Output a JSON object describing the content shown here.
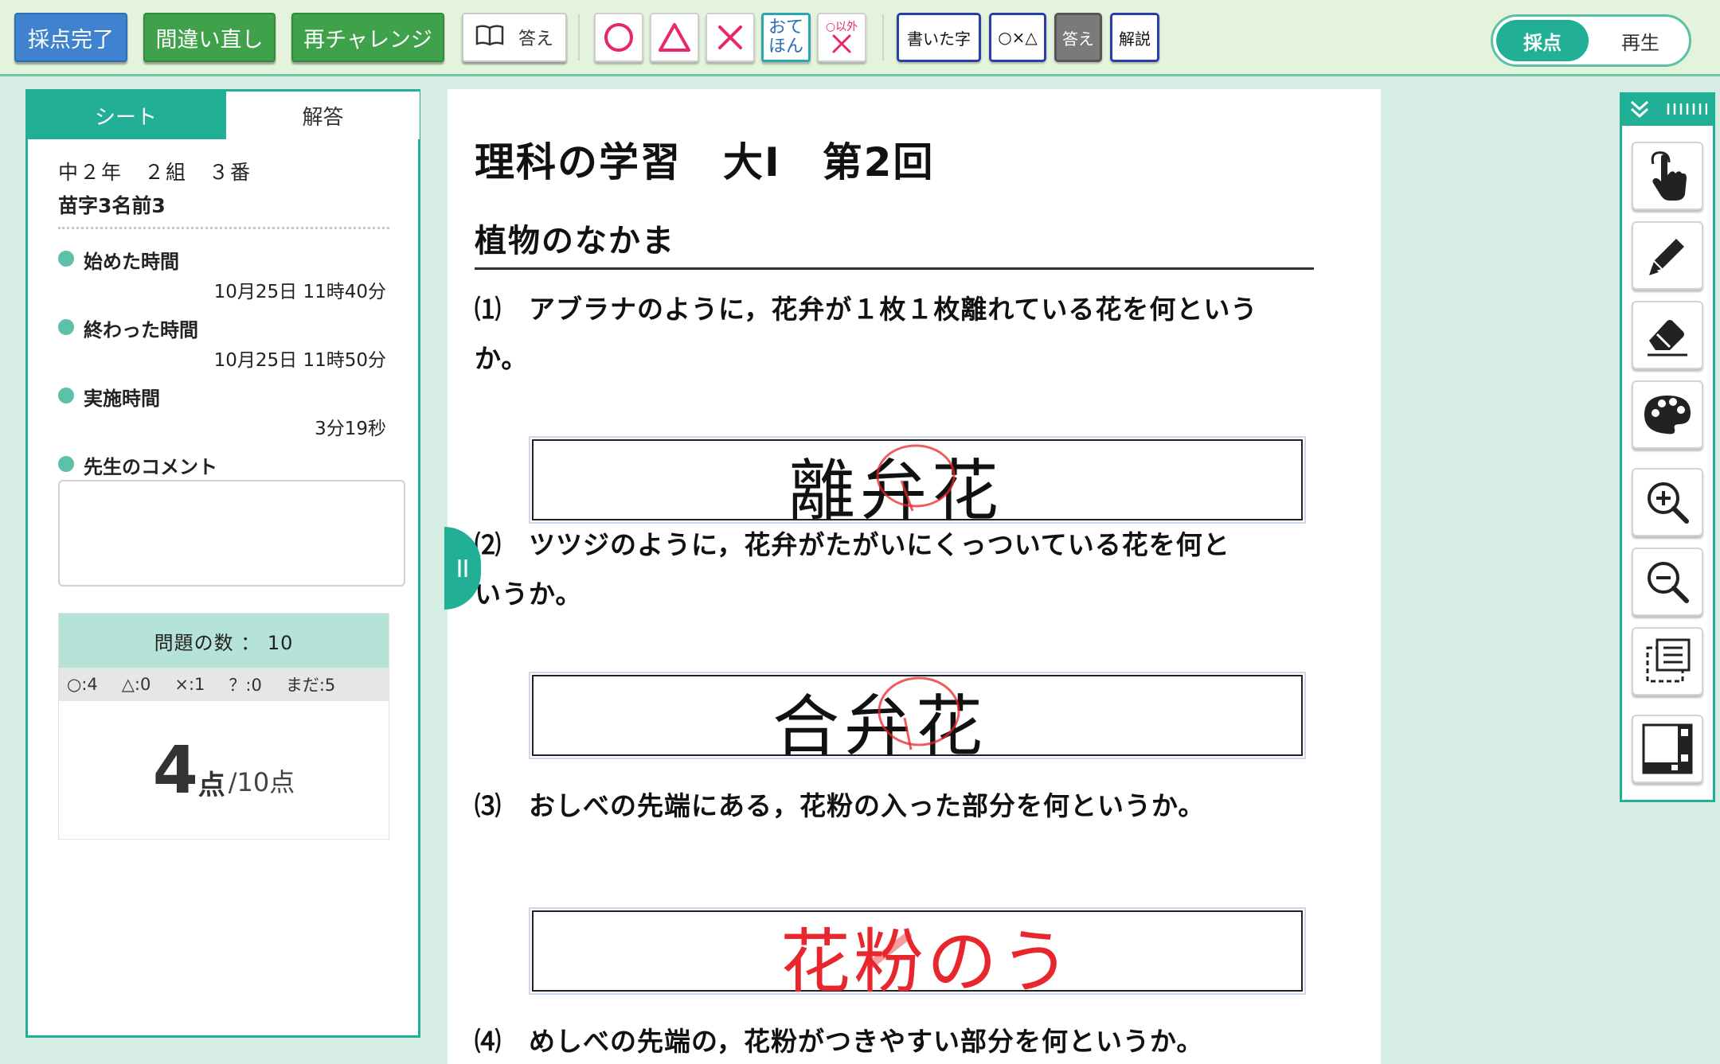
{
  "toolbar": {
    "finish_grading": "採点完了",
    "retry_mistakes": "間違い直し",
    "rechallenge": "再チャレンジ",
    "answer_book": "答え",
    "mark_model": "おてほん",
    "mark_other": "○以外",
    "filter_written": "書いた字",
    "filter_marks": "○×△",
    "filter_answer": "答え",
    "filter_explain": "解説"
  },
  "mode": {
    "grade": "採点",
    "play": "再生",
    "active": "grade"
  },
  "left": {
    "tabs": {
      "sheet": "シート",
      "answer": "解答"
    },
    "student_class": "中２年　２組　３番",
    "student_name": "苗字3名前3",
    "start_label": "始めた時間",
    "start_value": "10月25日 11時40分",
    "end_label": "終わった時間",
    "end_value": "10月25日 11時50分",
    "duration_label": "実施時間",
    "duration_value": "3分19秒",
    "comment_label": "先生のコメント",
    "question_count": "問題の数 ： 10",
    "counts": [
      "○:4",
      "△:0",
      "×:1",
      "？:0",
      "まだ:5"
    ],
    "score": "4",
    "score_unit": "点",
    "score_total": "/10点"
  },
  "doc": {
    "title": "理科の学習　大Ⅰ　第2回",
    "subtitle": "植物のなかま",
    "q1_line1": "⑴　アブラナのように，花弁が１枚１枚離れている花を何という",
    "q1_line2": "か。",
    "a1": "離弁花",
    "q2_line1": "⑵　ツツジのように，花弁がたがいにくっついている花を何と",
    "q2_line2": "いうか。",
    "a2": "合弁花",
    "q3": "⑶　おしべの先端にある，花粉の入った部分を何というか。",
    "a3": "花粉のう",
    "q4": "⑷　めしべの先端の，花粉がつきやすい部分を何というか。"
  },
  "colors": {
    "accent": "#21b096",
    "mark_red": "#e8262d",
    "ink": "#111111"
  }
}
